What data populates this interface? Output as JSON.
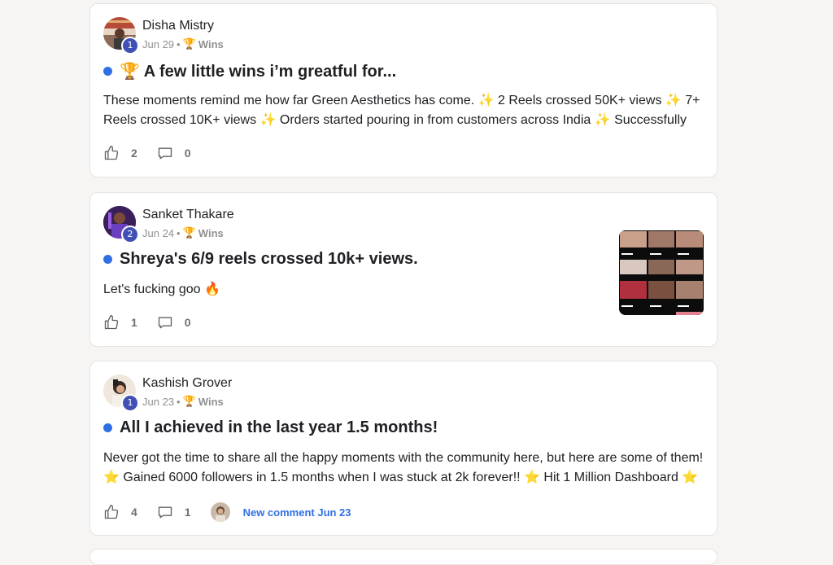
{
  "posts": [
    {
      "author": "Disha Mistry",
      "level": "1",
      "date": "Jun 29",
      "separator": "•",
      "category": "Wins",
      "title": "🏆 A few little wins i’m greatful for...",
      "body_line1": "These moments remind me how far Green Aesthetics has come. ✨ 2 Reels crossed 50K+ views ✨ 7+",
      "body_line2": "Reels crossed 10K+ views ✨ Orders started pouring in from customers across India ✨ Successfully",
      "likes": "2",
      "comments": "0"
    },
    {
      "author": "Sanket Thakare",
      "level": "2",
      "date": "Jun 24",
      "separator": "•",
      "category": "Wins",
      "title": "Shreya's 6/9 reels crossed 10k+ views.",
      "body_line1": "Let's fucking goo 🔥",
      "likes": "1",
      "comments": "0"
    },
    {
      "author": "Kashish Grover",
      "level": "1",
      "date": "Jun 23",
      "separator": "•",
      "category": "Wins",
      "title": "All I achieved in the last year 1.5 months!",
      "body_line1": "Never got the time to share all the happy moments with the community here, but here are some of them!",
      "body_line2": "⭐ Gained 6000 followers in 1.5 months when I was stuck at 2k forever!! ⭐ Hit 1 Million Dashboard ⭐",
      "likes": "4",
      "comments": "1",
      "new_comment": "New comment Jun 23"
    }
  ],
  "colors": {
    "accent": "#2f6fe4",
    "badge": "#3f51b5",
    "background": "#f6f5f4"
  },
  "icons": {
    "like": "thumbs-up-icon",
    "comment": "speech-bubble-icon",
    "category": "trophy-icon"
  }
}
